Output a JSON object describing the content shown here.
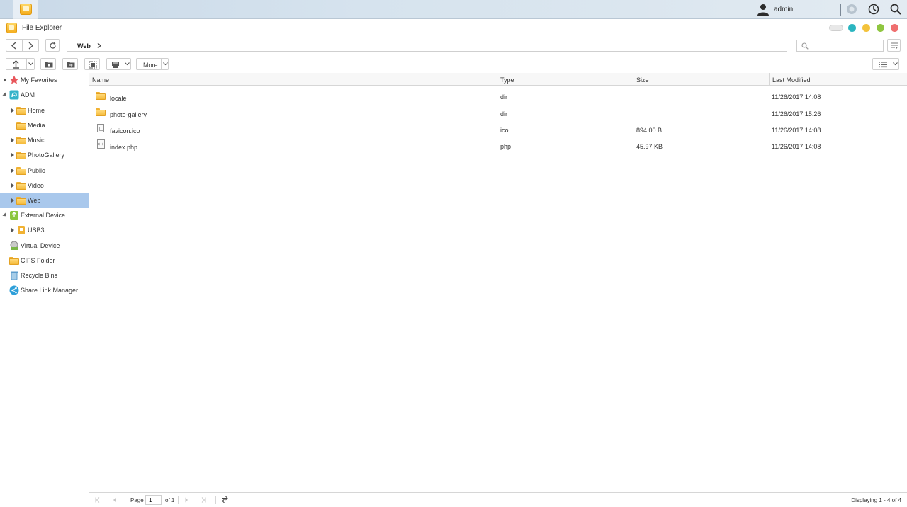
{
  "topbar": {
    "user": "admin"
  },
  "window": {
    "title": "File Explorer",
    "dot_colors": [
      "#2bb5c0",
      "#f3c23b",
      "#8fc640",
      "#ef6f6f"
    ]
  },
  "path": {
    "current": "Web"
  },
  "search": {
    "placeholder": ""
  },
  "toolbar": {
    "more_label": "More"
  },
  "sidebar": {
    "favorites": "My Favorites",
    "adm": "ADM",
    "home": "Home",
    "media": "Media",
    "music": "Music",
    "photogallery": "PhotoGallery",
    "public": "Public",
    "video": "Video",
    "web": "Web",
    "external": "External Device",
    "usb3": "USB3",
    "virtual": "Virtual Device",
    "cifs": "CIFS Folder",
    "recycle": "Recycle Bins",
    "sharelink": "Share Link Manager"
  },
  "columns": {
    "name": "Name",
    "type": "Type",
    "size": "Size",
    "modified": "Last Modified"
  },
  "files": [
    {
      "name": "locale",
      "type": "dir",
      "size": "",
      "modified": "11/26/2017 14:08",
      "kind": "folder-icon"
    },
    {
      "name": "photo-gallery",
      "type": "dir",
      "size": "",
      "modified": "11/26/2017 15:26",
      "kind": "folder-icon"
    },
    {
      "name": "favicon.ico",
      "type": "ico",
      "size": "894.00 B",
      "modified": "11/26/2017 14:08",
      "kind": "image-file-icon"
    },
    {
      "name": "index.php",
      "type": "php",
      "size": "45.97 KB",
      "modified": "11/26/2017 14:08",
      "kind": "code-file-icon"
    }
  ],
  "pager": {
    "page_label": "Page",
    "page_value": "1",
    "of_label": "of 1",
    "status": "Displaying 1 - 4 of 4"
  }
}
